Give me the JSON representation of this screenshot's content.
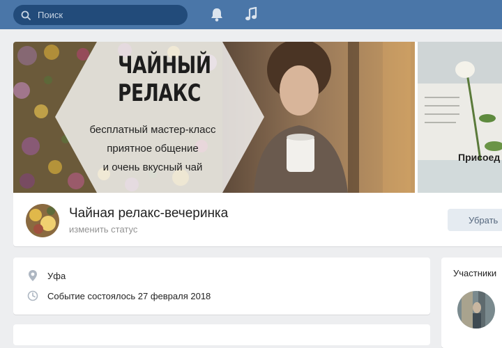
{
  "topbar": {
    "search_placeholder": "Поиск",
    "icons": [
      "search-icon",
      "bell-icon",
      "music-icon"
    ],
    "colors": {
      "bar": "#4a76a8",
      "search_bg": "#224b7a"
    }
  },
  "cover": {
    "title_line1": "ЧАЙНЫЙ",
    "title_line2": "РЕЛАКС",
    "line1": "бесплатный мастер-класс",
    "line2": "приятное общение",
    "line3": "и очень вкусный чай",
    "join_text": "Присоед"
  },
  "group": {
    "name": "Чайная релакс-вечеринка",
    "status": "изменить статус",
    "remove_button": "Убрать"
  },
  "info": {
    "location": "Уфа",
    "event": "Событие состоялось 27 февраля 2018",
    "icons": [
      "location-pin-icon",
      "clock-icon"
    ]
  },
  "members": {
    "title": "Участники"
  }
}
